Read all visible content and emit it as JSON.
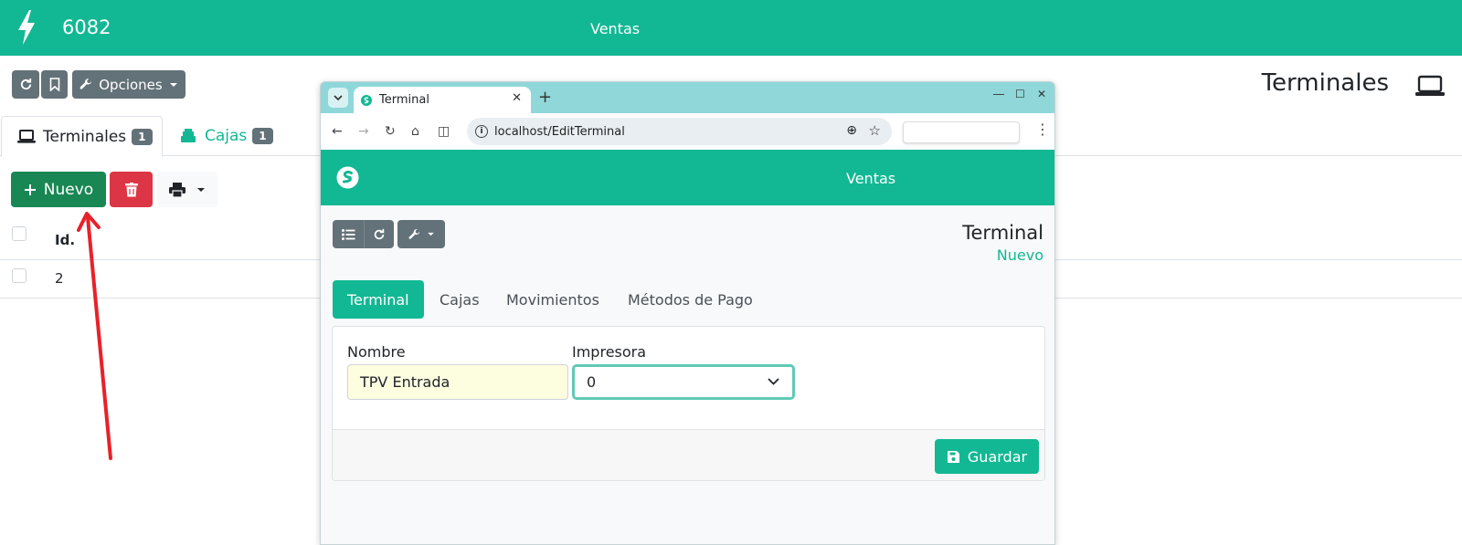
{
  "topbar": {
    "app_number": "6082",
    "section": "Ventas"
  },
  "toolbar": {
    "options_label": "Opciones"
  },
  "page": {
    "title": "Terminales"
  },
  "tabs": [
    {
      "label": "Terminales",
      "count": "1"
    },
    {
      "label": "Cajas",
      "count": "1"
    }
  ],
  "actions": {
    "new_label": "Nuevo"
  },
  "table": {
    "header_id": "Id.",
    "rows": [
      {
        "id": "2"
      }
    ]
  },
  "popup": {
    "tab_title": "Terminal",
    "url": "localhost/EditTerminal",
    "section": "Ventas",
    "title": "Terminal",
    "subtitle": "Nuevo",
    "tabs": [
      "Terminal",
      "Cajas",
      "Movimientos",
      "Métodos de Pago"
    ],
    "form": {
      "name_label": "Nombre",
      "name_value": "TPV Entrada",
      "printer_label": "Impresora",
      "printer_value": "0"
    },
    "save_label": "Guardar"
  },
  "colors": {
    "brand": "#12b894",
    "success": "#198754",
    "danger": "#dc3545",
    "secondary": "#637178"
  }
}
